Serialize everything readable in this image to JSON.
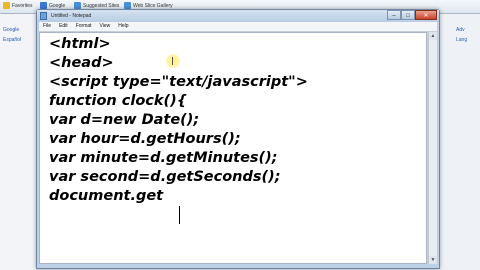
{
  "browser": {
    "favorites_bar": {
      "items": [
        {
          "label": "Favorites",
          "icon": "star-icon"
        },
        {
          "label": "Google",
          "icon": "google-icon"
        },
        {
          "label": "Suggested Sites",
          "icon": "ie-icon"
        },
        {
          "label": "Web Slice Gallery",
          "icon": "ie-icon"
        }
      ]
    },
    "left_links": [
      "Google",
      "Español"
    ],
    "right_links": [
      "Adv",
      "Lang"
    ]
  },
  "notepad": {
    "title": "Untitled - Notepad",
    "window_buttons": {
      "minimize": "–",
      "maximize": "□",
      "close": "✕"
    },
    "menu": [
      "File",
      "Edit",
      "Format",
      "View",
      "Help"
    ],
    "editor": {
      "lines": [
        "<html>",
        "<head>",
        "<script type=\"text/javascript\">",
        "function clock(){",
        "var d=new Date();",
        "var hour=d.getHours();",
        "var minute=d.getMinutes();",
        "var second=d.getSeconds();",
        "document.get"
      ]
    },
    "scrollbar": {
      "up": "▲",
      "down": "▼"
    }
  },
  "colors": {
    "title_bar": "#c4d6ea",
    "close_button": "#c9442b",
    "editor_background": "#ffffff",
    "text": "#000000"
  }
}
